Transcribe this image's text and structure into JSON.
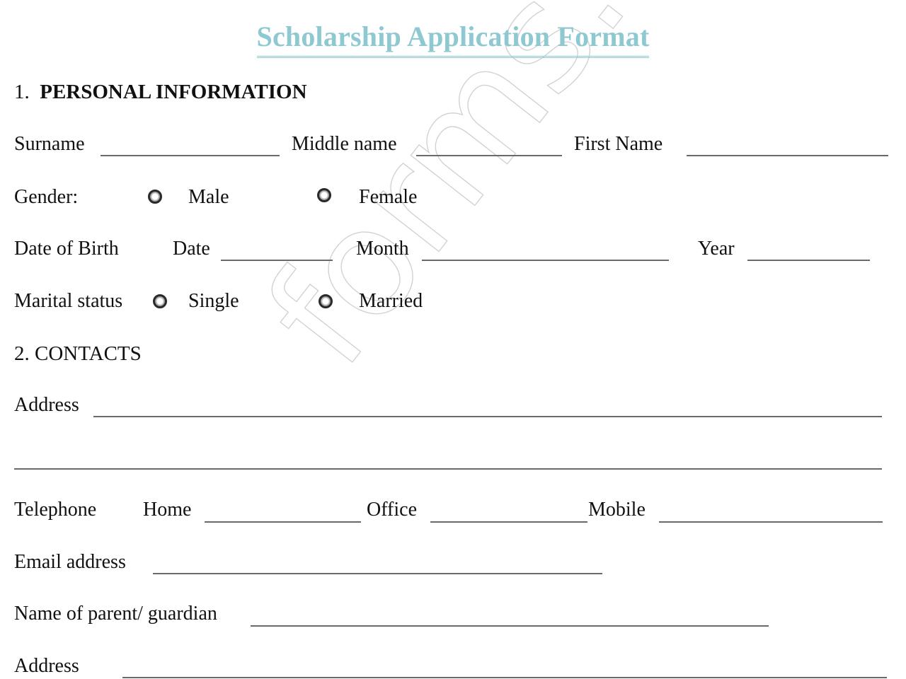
{
  "title": "Scholarship Application Format",
  "watermark": "forms.com",
  "colors": {
    "title": "#8ec9d1",
    "text": "#111111",
    "rule": "#6a6a6a"
  },
  "sections": {
    "personal": {
      "number": "1.",
      "heading": "PERSONAL INFORMATION"
    },
    "contacts": {
      "number": "2.",
      "heading": "CONTACTS"
    }
  },
  "fields": {
    "surname": "Surname",
    "middle_name": "Middle name",
    "first_name": "First Name",
    "gender": {
      "label": "Gender:",
      "options": [
        "Male",
        "Female"
      ],
      "selected": null
    },
    "dob": {
      "label": "Date of Birth",
      "date": "Date",
      "month": "Month",
      "year": "Year"
    },
    "marital": {
      "label": "Marital status",
      "options": [
        "Single",
        "Married"
      ],
      "selected": null
    },
    "address": "Address",
    "telephone": {
      "label": "Telephone",
      "home": "Home",
      "office": "Office",
      "mobile": "Mobile"
    },
    "email": "Email address",
    "guardian": "Name of parent/ guardian",
    "guardian_address": "Address"
  }
}
